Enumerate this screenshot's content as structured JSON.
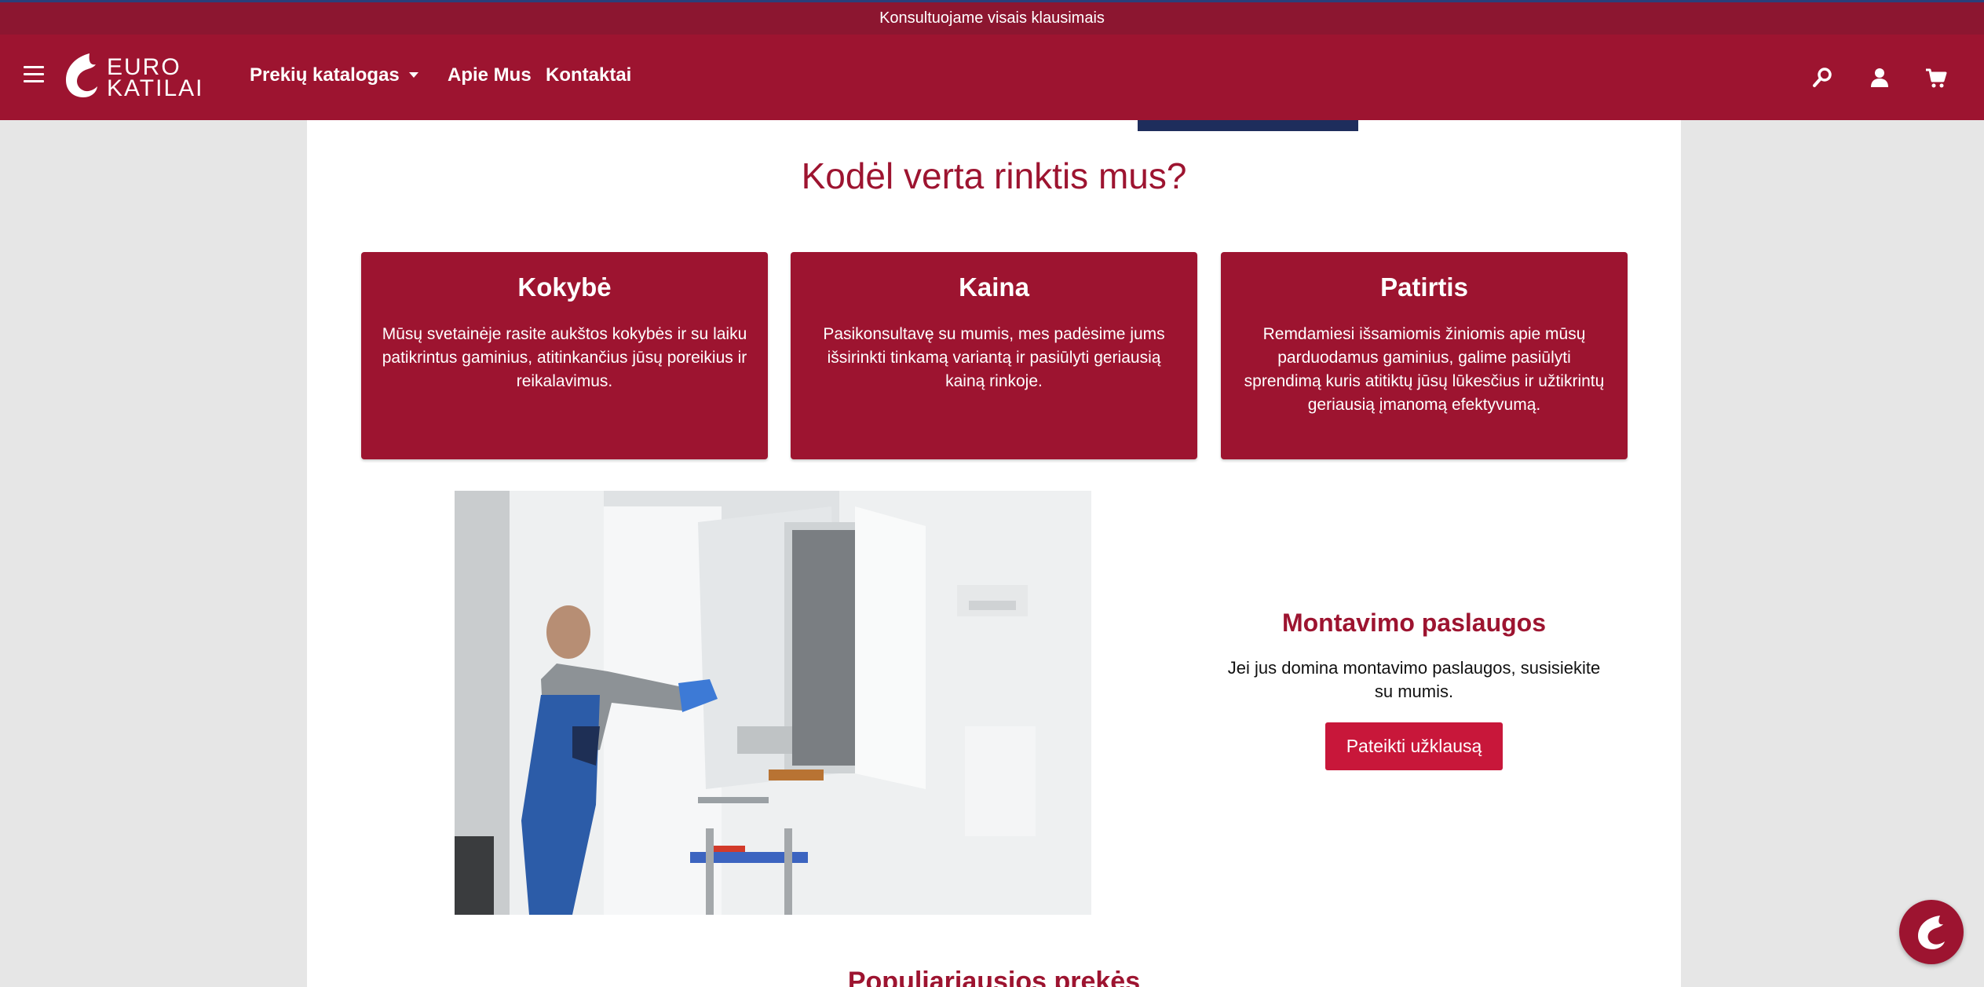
{
  "topbar": {
    "text": "Konsultuojame visais klausimais"
  },
  "header": {
    "logo_line1": "EURO",
    "logo_line2": "KATILAI",
    "nav": {
      "catalog": "Prekių katalogas",
      "about": "Apie Mus",
      "contacts": "Kontaktai"
    },
    "icons": [
      "search-icon",
      "user-icon",
      "cart-icon"
    ]
  },
  "main": {
    "title": "Kodėl verta rinktis mus?",
    "cards": [
      {
        "title": "Kokybė",
        "text": "Mūsų svetainėje rasite aukštos kokybės ir su laiku patikrintus gaminius, atitinkančius jūsų poreikius ir reikalavimus."
      },
      {
        "title": "Kaina",
        "text": "Pasikonsultavę su mumis, mes padėsime jums išsirinkti tinkamą variantą ir pasiūlyti geriausią kainą rinkoje."
      },
      {
        "title": "Patirtis",
        "text": "Remdamiesi išsamiomis žiniomis apie mūsų parduodamus gaminius, galime pasiūlyti sprendimą kuris atitiktų jūsų lūkesčius ir užtikrintų geriausią įmanomą efektyvumą."
      }
    ],
    "installation": {
      "title": "Montavimo paslaugos",
      "text": "Jei jus domina montavimo paslaugos, susisiekite su mumis.",
      "button": "Pateikti užklausą"
    },
    "next_section_title": "Populiariausios prekės"
  },
  "colors": {
    "brand": "#9d1430",
    "button": "#c8173a",
    "navy": "#1e2d5c"
  }
}
